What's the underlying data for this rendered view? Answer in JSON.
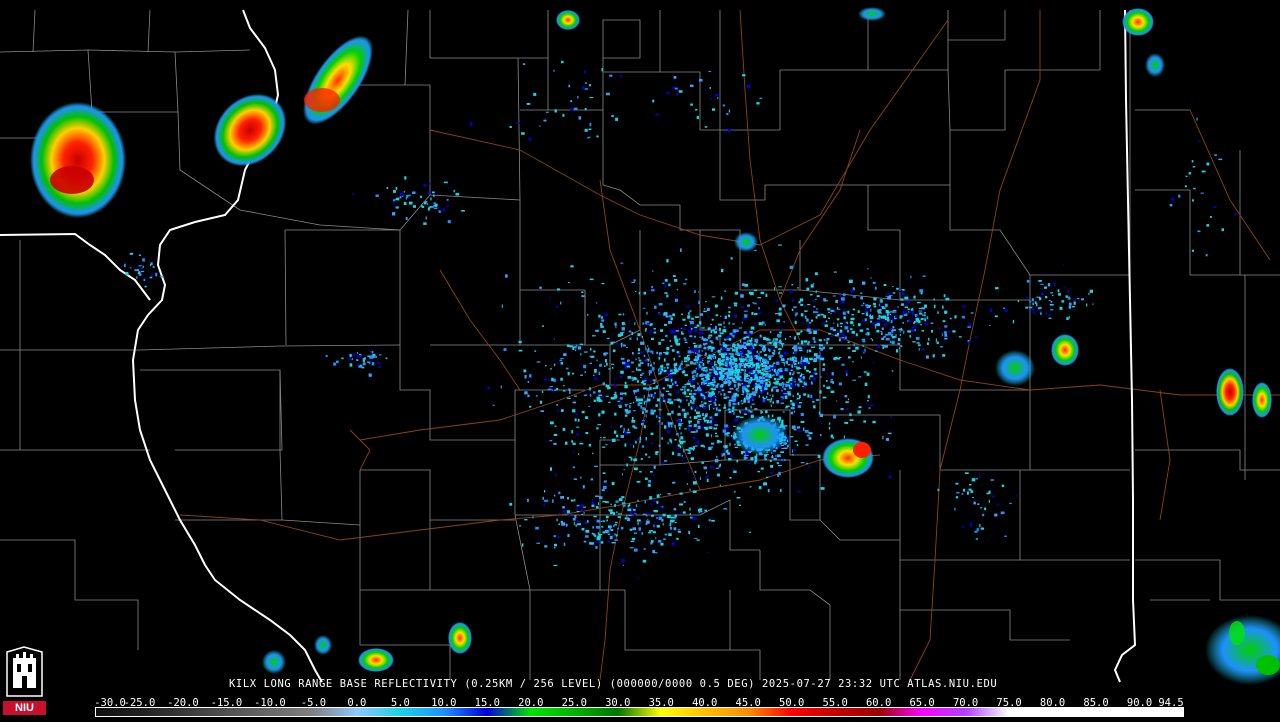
{
  "caption": "KILX LONG RANGE BASE REFLECTIVITY (0.25KM / 256 LEVEL) (000000/0000 0.5 DEG) 2025-07-27 23:32 UTC  ATLAS.NIU.EDU",
  "scale": {
    "labels": [
      "-30.0",
      "-25.0",
      "-20.0",
      "-15.0",
      "-10.0",
      "-5.0",
      "0.0",
      "5.0",
      "10.0",
      "15.0",
      "20.0",
      "25.0",
      "30.0",
      "35.0",
      "40.0",
      "45.0",
      "50.0",
      "55.0",
      "60.0",
      "65.0",
      "70.0",
      "75.0",
      "80.0",
      "85.0",
      "90.0",
      "94.5"
    ],
    "colors": [
      "#101010",
      "#202020",
      "#383838",
      "#505050",
      "#686868",
      "#808080",
      "#8cc8ff",
      "#19d3e6",
      "#1e90ff",
      "#0000dd",
      "#00e600",
      "#00b400",
      "#007800",
      "#ffff00",
      "#ffc000",
      "#ff8c00",
      "#ff0000",
      "#c80000",
      "#a00000",
      "#ff00ff",
      "#b040ff",
      "#ffffff",
      "#ffffff",
      "#ffffff",
      "#ffffff"
    ]
  },
  "logo": {
    "text": "NIU"
  },
  "colors": {
    "background": "#000000",
    "county_lines": "#8a8a8a",
    "state_lines": "#ffffff",
    "roads": "#8b4513"
  }
}
